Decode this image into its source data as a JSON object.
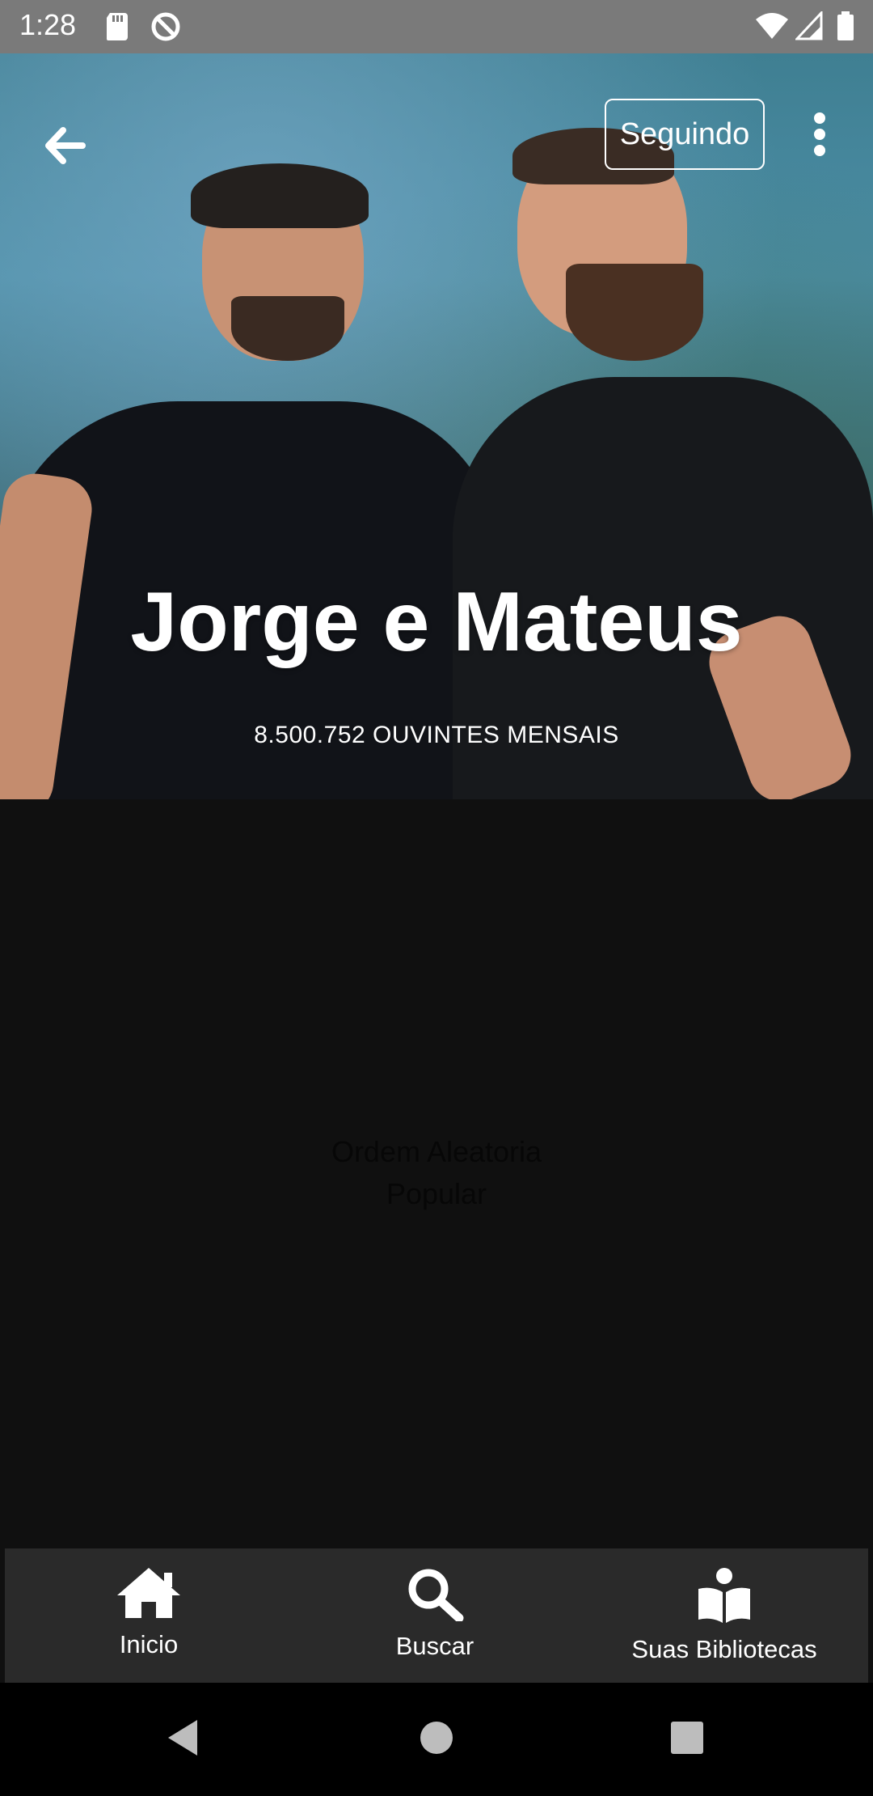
{
  "status_bar": {
    "time": "1:28",
    "left_icons": [
      "sd-card-icon",
      "data-saver-icon"
    ],
    "right_icons": [
      "wifi-icon",
      "cell-signal-icon",
      "battery-icon"
    ]
  },
  "header": {
    "back_icon": "arrow-left-icon",
    "follow_label": "Seguindo",
    "more_icon": "more-vertical-icon"
  },
  "artist": {
    "name": "Jorge e Mateus",
    "monthly_listeners": "8.500.752 OUVINTES MENSAIS"
  },
  "content": {
    "shuffle_label": "Ordem Aleatoria",
    "popular_label": "Popular"
  },
  "bottom_nav": {
    "items": [
      {
        "label": "Inicio",
        "icon": "home-icon"
      },
      {
        "label": "Buscar",
        "icon": "search-icon"
      },
      {
        "label": "Suas Bibliotecas",
        "icon": "library-icon"
      }
    ]
  },
  "system_nav": [
    "back-triangle-icon",
    "home-circle-icon",
    "recents-square-icon"
  ]
}
